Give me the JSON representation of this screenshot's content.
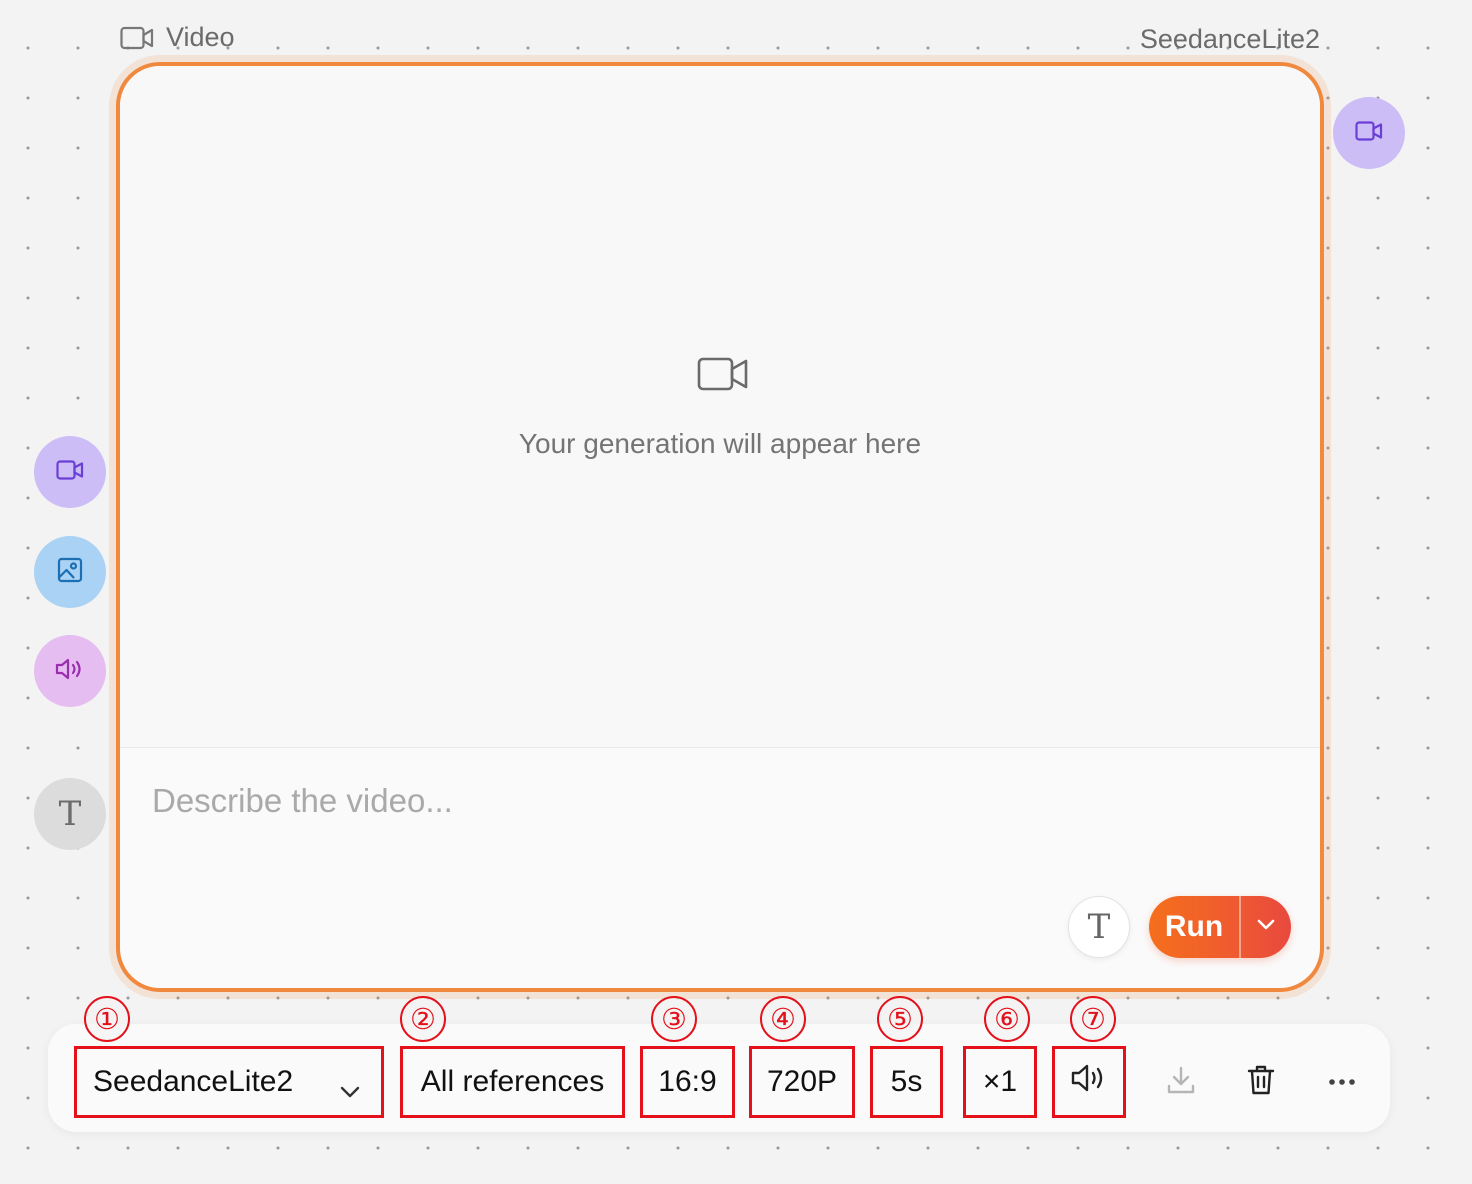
{
  "node": {
    "type_label": "Video",
    "type_icon": "video-camera-icon",
    "model_name": "SeedanceLite2"
  },
  "preview": {
    "icon": "video-camera-icon",
    "placeholder_text": "Your generation will appear here"
  },
  "prompt": {
    "placeholder": "Describe the video...",
    "value": ""
  },
  "actions": {
    "text_mode_glyph": "T",
    "run_label": "Run",
    "run_menu_icon": "chevron-down-icon"
  },
  "handles": {
    "output": "video-icon",
    "inputs": [
      "video-icon",
      "image-icon",
      "audio-icon",
      "text-icon"
    ],
    "text_glyph": "T"
  },
  "toolbar": {
    "model": "SeedanceLite2",
    "references": "All references",
    "aspect_ratio": "16:9",
    "resolution": "720P",
    "duration": "5s",
    "count": "×1",
    "audio_icon": "speaker-icon",
    "download_icon": "download-icon",
    "delete_icon": "trash-icon",
    "more_icon": "more-horizontal-icon"
  },
  "annotations": [
    "①",
    "②",
    "③",
    "④",
    "⑤",
    "⑥",
    "⑦"
  ],
  "colors": {
    "card_border": "#f0883e",
    "run_start": "#f56f1c",
    "run_end": "#e8493e",
    "annotation_red": "#e4101a",
    "video_handle": "#cdbdf6",
    "image_handle": "#a9d2f4",
    "audio_handle": "#e5bdf0",
    "text_handle": "#dcdcdc"
  }
}
